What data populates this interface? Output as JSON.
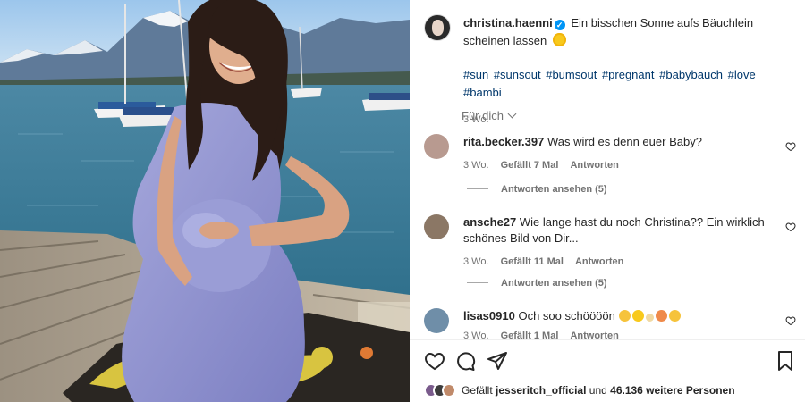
{
  "post": {
    "username": "christina.haenni",
    "caption": "Ein bisschen Sonne aufs Bäuchlein scheinen lassen",
    "hashtags": [
      "#sun",
      "#sunsout",
      "#bumsout",
      "#pregnant",
      "#babybauch",
      "#love",
      "#bambi"
    ],
    "time": "3 Wo."
  },
  "filter_label": "Für dich",
  "comments": [
    {
      "username": "rita.becker.397",
      "text": "Was wird es denn euer Baby?",
      "time": "3 Wo.",
      "likes": "Gefällt 7 Mal",
      "reply": "Antworten",
      "view_replies": "Antworten ansehen (5)"
    },
    {
      "username": "ansche27",
      "text": "Wie lange hast du noch Christina?? Ein wirklich schönes Bild von Dir...",
      "time": "3 Wo.",
      "likes": "Gefällt 11 Mal",
      "reply": "Antworten",
      "view_replies": "Antworten ansehen (5)"
    },
    {
      "username": "lisas0910",
      "text": "Och soo schöööön",
      "time": "3 Wo.",
      "likes": "Gefällt 1 Mal",
      "reply": "Antworten"
    }
  ],
  "likes_summary": {
    "prefix": "Gefällt",
    "user": "jesseritch_official",
    "middle": "und",
    "count": "46.136 weitere Personen"
  },
  "icons": [
    "heart-icon",
    "comment-icon",
    "share-icon",
    "bookmark-icon",
    "verified-badge-icon",
    "sun-emoji",
    "chevron-down-icon"
  ],
  "colors": {
    "link": "#00376b",
    "muted": "#737373",
    "verified": "#0095f6"
  }
}
